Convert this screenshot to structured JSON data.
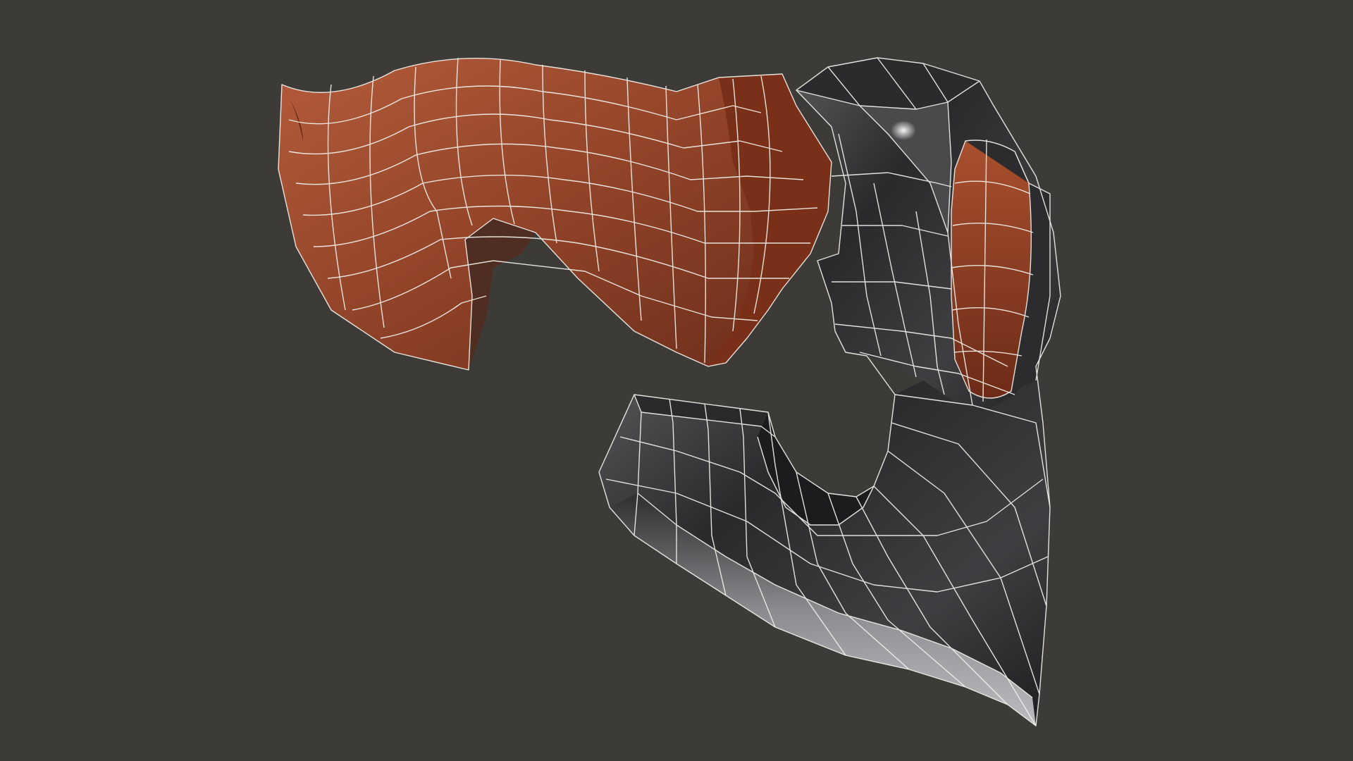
{
  "scene": {
    "background_color": "#3d3b37",
    "subject": "axe-model",
    "display_mode": "wireframe-on-shaded",
    "wire_color": "#f2f0ea",
    "materials": {
      "wood": {
        "base": "#8a3d24",
        "light": "#b2593a",
        "dark": "#5c2414"
      },
      "metal": {
        "base": "#3a3a3c",
        "light": "#c9c9cc",
        "dark": "#151516"
      }
    }
  }
}
